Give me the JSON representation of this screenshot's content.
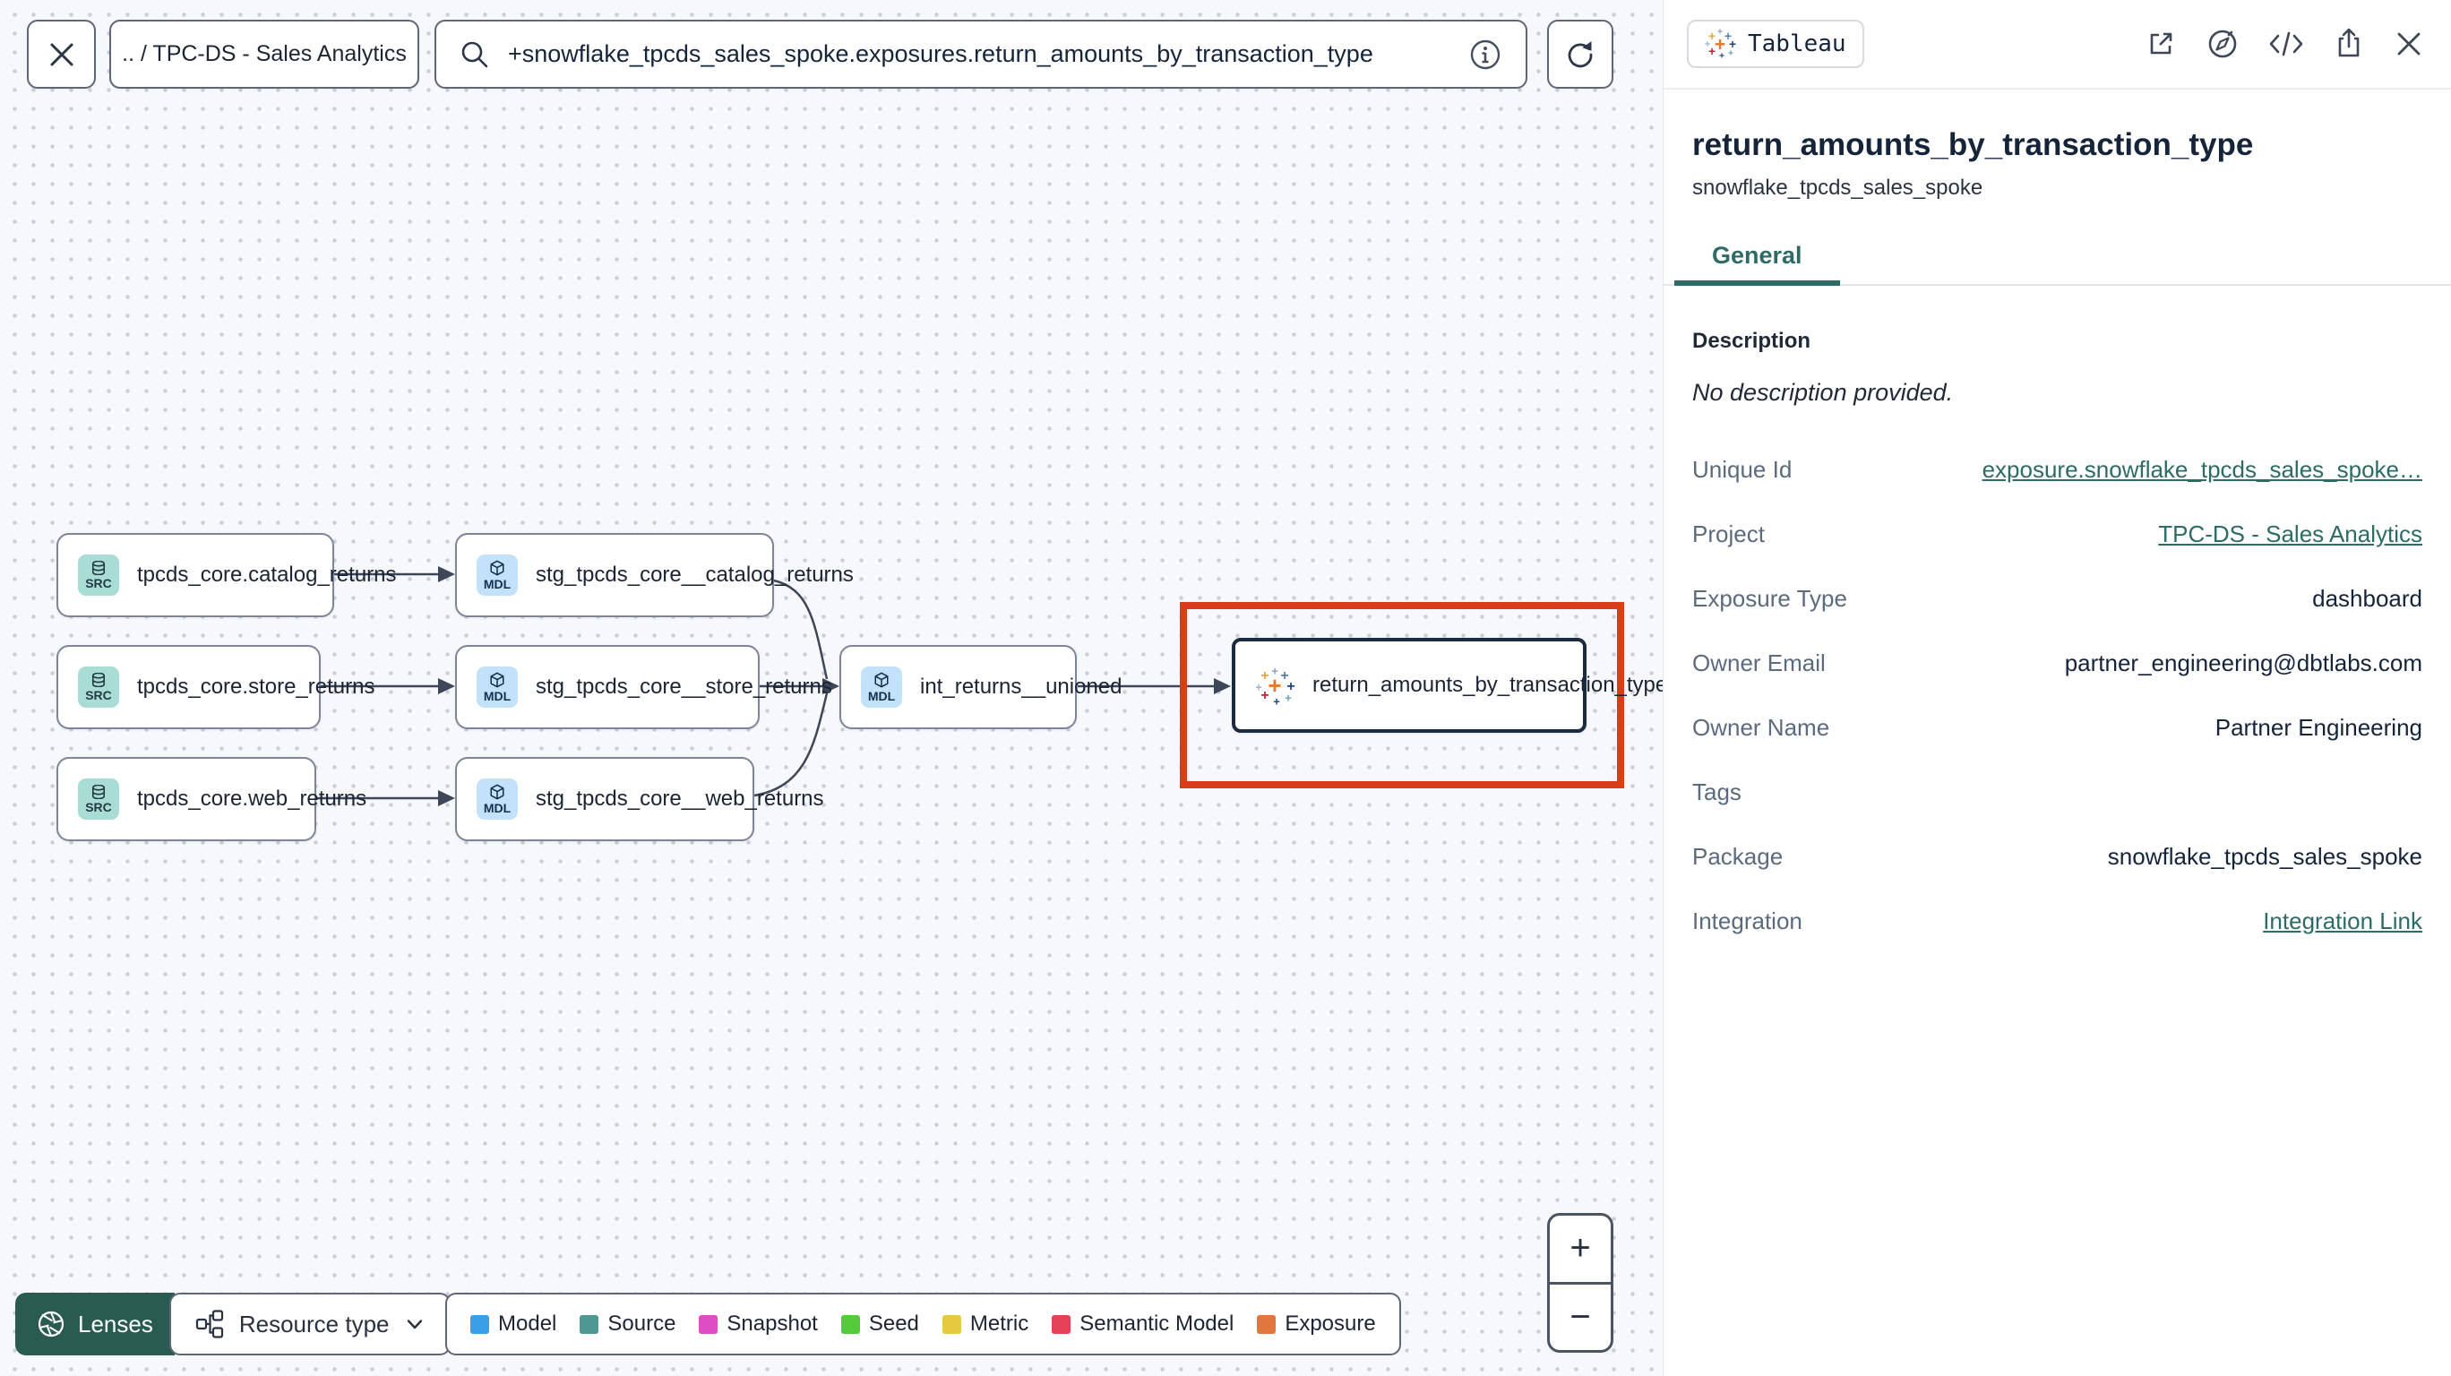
{
  "toolbar": {
    "breadcrumb": ".. / TPC-DS - Sales Analytics",
    "search_value": "+snowflake_tpcds_sales_spoke.exposures.return_amounts_by_transaction_type"
  },
  "graph": {
    "nodes": [
      {
        "badge": "SRC",
        "label": "tpcds_core.catalog_returns"
      },
      {
        "badge": "MDL",
        "label": "stg_tpcds_core__catalog_returns"
      },
      {
        "badge": "SRC",
        "label": "tpcds_core.store_returns"
      },
      {
        "badge": "MDL",
        "label": "stg_tpcds_core__store_returns"
      },
      {
        "badge": "SRC",
        "label": "tpcds_core.web_returns"
      },
      {
        "badge": "MDL",
        "label": "stg_tpcds_core__web_returns"
      },
      {
        "badge": "MDL",
        "label": "int_returns__unioned"
      },
      {
        "badge": "tableau",
        "label": "return_amounts_by_transaction_type"
      }
    ]
  },
  "lenses": {
    "label": "Lenses",
    "resource_type_label": "Resource type"
  },
  "legend": {
    "items": [
      {
        "label": "Model",
        "color": "#3B9FE8"
      },
      {
        "label": "Source",
        "color": "#4E9793"
      },
      {
        "label": "Snapshot",
        "color": "#DD4EC4"
      },
      {
        "label": "Seed",
        "color": "#54CB3A"
      },
      {
        "label": "Metric",
        "color": "#E7C93F"
      },
      {
        "label": "Semantic Model",
        "color": "#E54258"
      },
      {
        "label": "Exposure",
        "color": "#E1763E"
      }
    ]
  },
  "zoom_controls": {
    "zoom_in": "+",
    "zoom_out": "−"
  },
  "panel": {
    "badge": "Tableau",
    "title": "return_amounts_by_transaction_type",
    "subtitle": "snowflake_tpcds_sales_spoke",
    "tab": "General",
    "description_label": "Description",
    "description": "No description provided.",
    "fields": [
      {
        "label": "Unique Id",
        "value": "exposure.snowflake_tpcds_sales_spoke",
        "suffix": "…"
      },
      {
        "label": "Project",
        "value": "TPC-DS - Sales Analytics"
      },
      {
        "label": "Exposure Type",
        "value": "dashboard"
      },
      {
        "label": "Owner Email",
        "value": "partner_engineering@dbtlabs.com"
      },
      {
        "label": "Owner Name",
        "value": "Partner Engineering"
      },
      {
        "label": "Tags",
        "value": ""
      },
      {
        "label": "Package",
        "value": "snowflake_tpcds_sales_spoke"
      },
      {
        "label": "Integration",
        "value": "Integration Link"
      }
    ]
  }
}
